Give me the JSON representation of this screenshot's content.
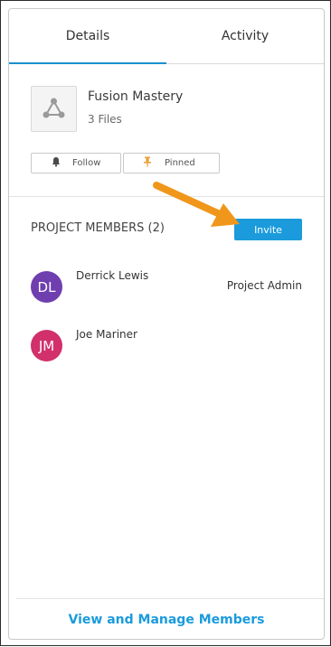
{
  "tabs": [
    {
      "label": "Details",
      "active": true
    },
    {
      "label": "Activity",
      "active": false
    }
  ],
  "project": {
    "name": "Fusion Mastery",
    "files": "3 Files",
    "thumbnail_icon": "project-graph-icon"
  },
  "actions": {
    "follow_label": "Follow",
    "pinned_label": "Pinned"
  },
  "members_section": {
    "title": "PROJECT MEMBERS (2)",
    "invite_label": "Invite",
    "members": [
      {
        "initials": "DL",
        "name": "Derrick Lewis",
        "role": "Project Admin",
        "color": "#6f3fb0"
      },
      {
        "initials": "JM",
        "name": "Joe Mariner",
        "role": "",
        "color": "#d1306a"
      }
    ]
  },
  "footer": {
    "manage_label": "View and Manage Members"
  },
  "colors": {
    "accent": "#1b9bdc",
    "annotation_arrow": "#f0961b",
    "pin": "#e8a23a"
  }
}
